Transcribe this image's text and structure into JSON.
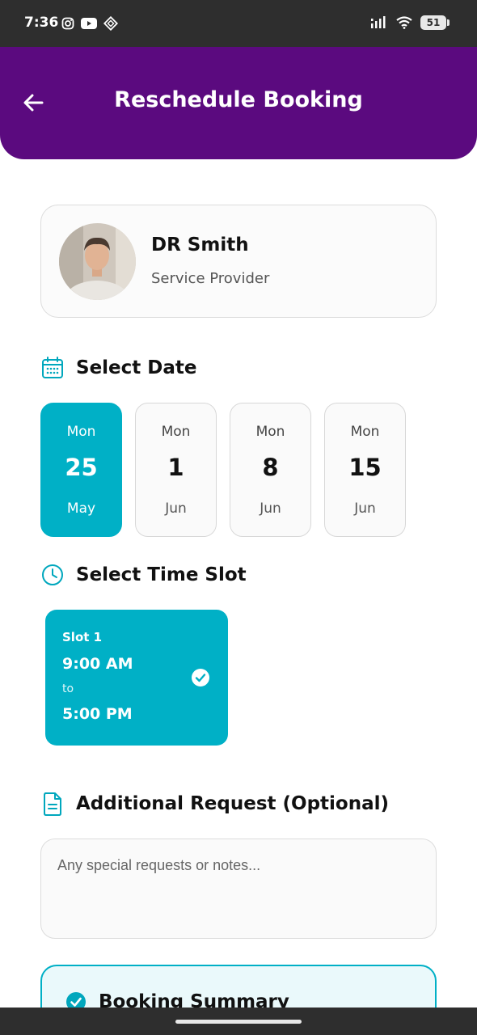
{
  "status_bar": {
    "time": "7:36",
    "battery": "51",
    "left_icons": [
      "instagram-icon",
      "youtube-icon",
      "app-diamond-icon"
    ],
    "right_icons": [
      "signal-icon",
      "wifi-icon",
      "battery-icon"
    ]
  },
  "header": {
    "title": "Reschedule Booking",
    "back_icon": "arrow-left-icon",
    "background_color": "#5b0a7f"
  },
  "provider": {
    "name": "DR Smith",
    "role": "Service Provider"
  },
  "select_date": {
    "title": "Select Date",
    "icon": "calendar-icon",
    "dates": [
      {
        "day": "Mon",
        "date": "25",
        "month": "May",
        "selected": true
      },
      {
        "day": "Mon",
        "date": "1",
        "month": "Jun",
        "selected": false
      },
      {
        "day": "Mon",
        "date": "8",
        "month": "Jun",
        "selected": false
      },
      {
        "day": "Mon",
        "date": "15",
        "month": "Jun",
        "selected": false
      }
    ]
  },
  "select_time": {
    "title": "Select Time Slot",
    "icon": "clock-icon",
    "slots": [
      {
        "label": "Slot 1",
        "start": "9:00 AM",
        "to": "to",
        "end": "5:00 PM",
        "selected": true
      }
    ]
  },
  "additional_request": {
    "title": "Additional Request (Optional)",
    "icon": "document-icon",
    "value": "",
    "placeholder": "Any special requests or notes..."
  },
  "summary": {
    "title": "Booking Summary",
    "icon": "check-circle-icon"
  },
  "colors": {
    "accent": "#00b0c6",
    "header": "#5b0a7f",
    "summary_bg": "#eaf9fb"
  }
}
